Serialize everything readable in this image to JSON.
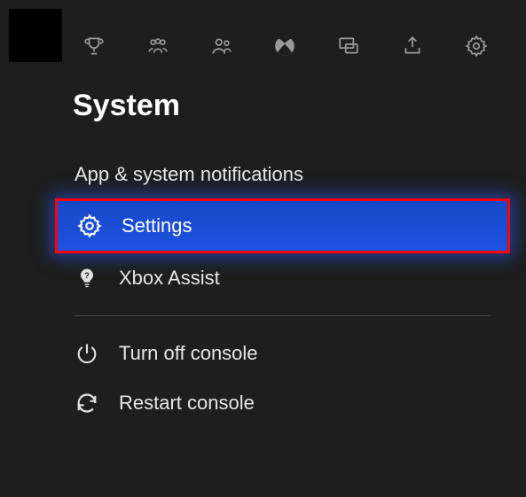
{
  "header": {
    "title": "System"
  },
  "menu": {
    "notifications": "App & system notifications",
    "settings": "Settings",
    "xbox_assist": "Xbox Assist",
    "turn_off": "Turn off console",
    "restart": "Restart console"
  }
}
